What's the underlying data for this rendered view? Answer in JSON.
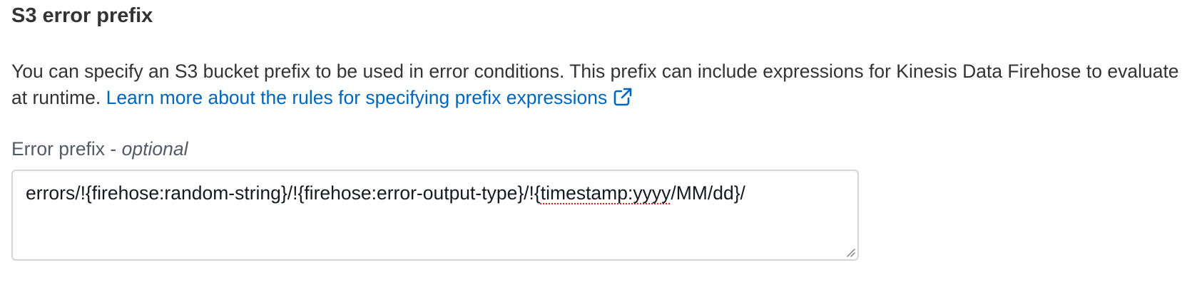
{
  "section": {
    "title": "S3 error prefix",
    "description": "You can specify an S3 bucket prefix to be used in error conditions. This prefix can include expressions for Kinesis Data Firehose to evaluate at runtime.",
    "link_label": "Learn more about the rules for specifying prefix expressions",
    "link_icon": "external-link-icon"
  },
  "field": {
    "label": "Error prefix",
    "label_separator": " - ",
    "optional_label": "optional",
    "value_prefix": "errors/!{firehose:random-string}/!{firehose:error-output-type}/!{",
    "value_misspelled": "timestamp:yyyy",
    "value_suffix": "/MM/dd}/"
  },
  "colors": {
    "text": "#333333",
    "link": "#0066bb",
    "label": "#545b64",
    "border": "#d4d6d8",
    "spellcheck": "#e02020"
  }
}
